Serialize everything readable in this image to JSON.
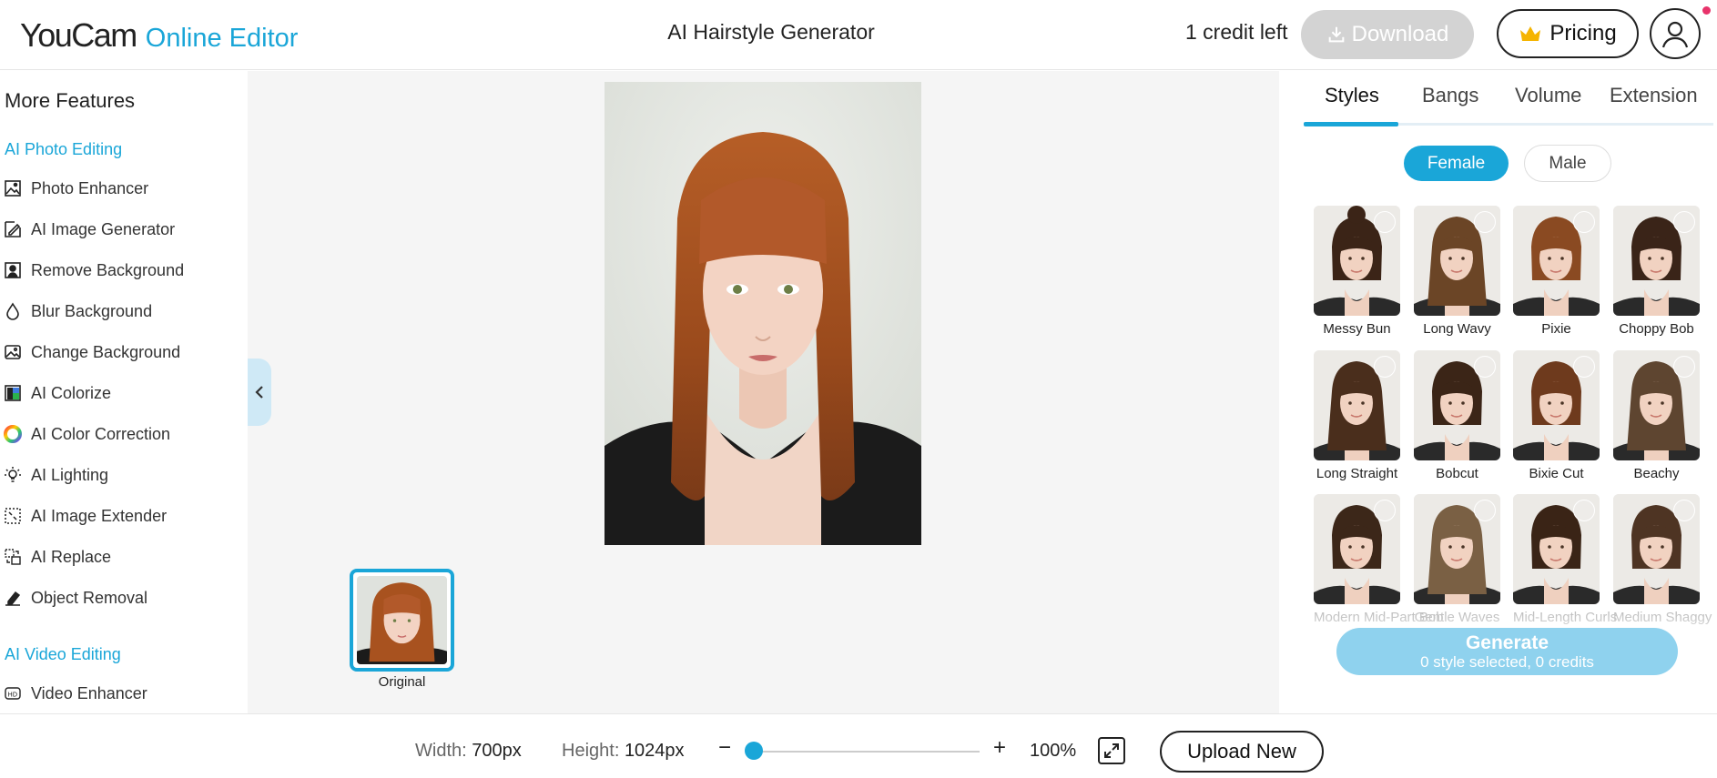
{
  "header": {
    "logo_main": "YouCam",
    "logo_sub": "Online Editor",
    "title": "AI Hairstyle Generator",
    "credits": "1 credit left",
    "download_label": "Download",
    "pricing_label": "Pricing"
  },
  "sidebar": {
    "title": "More Features",
    "section_photo": "AI Photo Editing",
    "section_video": "AI Video Editing",
    "photo_items": [
      {
        "label": "Photo Enhancer",
        "icon": "photo-enhancer-icon"
      },
      {
        "label": "AI Image Generator",
        "icon": "image-generator-icon"
      },
      {
        "label": "Remove Background",
        "icon": "remove-background-icon"
      },
      {
        "label": "Blur Background",
        "icon": "blur-drop-icon"
      },
      {
        "label": "Change Background",
        "icon": "change-background-icon"
      },
      {
        "label": "AI Colorize",
        "icon": "colorize-icon"
      },
      {
        "label": "AI Color Correction",
        "icon": "color-wheel-icon"
      },
      {
        "label": "AI Lighting",
        "icon": "lightbulb-icon"
      },
      {
        "label": "AI Image Extender",
        "icon": "extender-icon"
      },
      {
        "label": "AI Replace",
        "icon": "replace-icon"
      },
      {
        "label": "Object Removal",
        "icon": "eraser-icon"
      }
    ],
    "video_items": [
      {
        "label": "Video Enhancer",
        "icon": "hd-video-icon"
      }
    ]
  },
  "canvas": {
    "thumb_label": "Original"
  },
  "panel": {
    "tabs": [
      "Styles",
      "Bangs",
      "Volume",
      "Extension"
    ],
    "gender_female": "Female",
    "gender_male": "Male",
    "styles": [
      {
        "name": "Messy Bun",
        "hair": "#3b2417"
      },
      {
        "name": "Long Wavy",
        "hair": "#6b4526"
      },
      {
        "name": "Pixie",
        "hair": "#8a4a22"
      },
      {
        "name": "Choppy Bob",
        "hair": "#3a2418"
      },
      {
        "name": "Long Straight",
        "hair": "#4a2e1c"
      },
      {
        "name": "Bobcut",
        "hair": "#3b2517"
      },
      {
        "name": "Bixie Cut",
        "hair": "#6e3a1d"
      },
      {
        "name": "Beachy",
        "hair": "#5e4530"
      },
      {
        "name": "Modern Mid-Part Bob",
        "hair": "#3c2719"
      },
      {
        "name": "Gentle Waves",
        "hair": "#7a6044"
      },
      {
        "name": "Mid-Length Curls",
        "hair": "#3a2416"
      },
      {
        "name": "Medium Shaggy",
        "hair": "#4e3423"
      }
    ],
    "generate_label": "Generate",
    "generate_sub": "0 style selected, 0 credits"
  },
  "bottom": {
    "width_label": "Width:",
    "width_value": "700px",
    "height_label": "Height:",
    "height_value": "1024px",
    "zoom_value": "100%",
    "zoom_level": 0.0,
    "upload_label": "Upload New"
  },
  "colors": {
    "accent": "#1aa6d8",
    "photo_hair": "#a8521f"
  }
}
